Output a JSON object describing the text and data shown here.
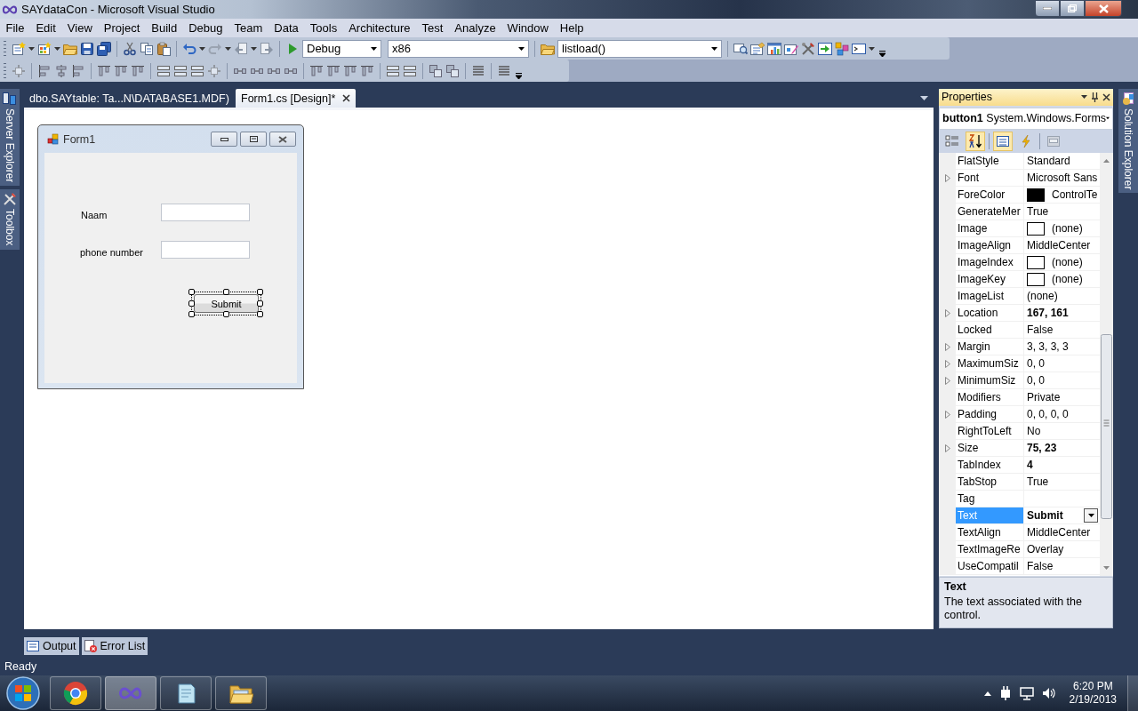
{
  "window": {
    "title": "SAYdataCon - Microsoft Visual Studio"
  },
  "menu": [
    "File",
    "Edit",
    "View",
    "Project",
    "Build",
    "Debug",
    "Team",
    "Data",
    "Tools",
    "Architecture",
    "Test",
    "Analyze",
    "Window",
    "Help"
  ],
  "toolbar": {
    "configuration": "Debug",
    "platform": "x86",
    "find": "listload()"
  },
  "left_side_tabs": [
    {
      "label": "Server Explorer",
      "kind": "server"
    },
    {
      "label": "Toolbox",
      "kind": "toolbox"
    }
  ],
  "document_tabs": [
    {
      "label": "dbo.SAYtable: Ta...N\\DATABASE1.MDF)",
      "selected": false
    },
    {
      "label": "Form1.cs [Design]*",
      "selected": true
    }
  ],
  "form": {
    "title": "Form1",
    "fields": [
      {
        "label": "Naam"
      },
      {
        "label": "phone number"
      }
    ],
    "button": {
      "text": "Submit",
      "selected": true
    }
  },
  "properties": {
    "title": "Properties",
    "object": "**button1** System.Windows.Forms",
    "view_buttons": [
      {
        "kind": "categorized",
        "selected": false
      },
      {
        "kind": "alphabetical",
        "selected": true
      },
      {
        "kind": "properties",
        "selected": true
      },
      {
        "kind": "events",
        "selected": false
      },
      {
        "kind": "pages",
        "selected": false
      }
    ],
    "rows": [
      {
        "name": "FlatStyle",
        "value": "Standard",
        "kind": "text",
        "expandable": false,
        "bold": false,
        "selected": false
      },
      {
        "name": "Font",
        "value": "Microsoft Sans",
        "kind": "text",
        "expandable": true,
        "bold": false,
        "selected": false
      },
      {
        "name": "ForeColor",
        "value": "ControlTe",
        "kind": "swatch",
        "color": "#000000",
        "expandable": false,
        "bold": false,
        "selected": false
      },
      {
        "name": "GenerateMer",
        "value": "True",
        "kind": "text",
        "expandable": false,
        "bold": false,
        "selected": false
      },
      {
        "name": "Image",
        "value": "(none)",
        "kind": "swatch",
        "color": "#ffffff",
        "expandable": false,
        "bold": false,
        "selected": false
      },
      {
        "name": "ImageAlign",
        "value": "MiddleCenter",
        "kind": "text",
        "expandable": false,
        "bold": false,
        "selected": false
      },
      {
        "name": "ImageIndex",
        "value": "(none)",
        "kind": "swatch",
        "color": "#ffffff",
        "expandable": false,
        "bold": false,
        "selected": false
      },
      {
        "name": "ImageKey",
        "value": "(none)",
        "kind": "swatch",
        "color": "#ffffff",
        "expandable": false,
        "bold": false,
        "selected": false
      },
      {
        "name": "ImageList",
        "value": "(none)",
        "kind": "text",
        "expandable": false,
        "bold": false,
        "selected": false
      },
      {
        "name": "Location",
        "value": "167, 161",
        "kind": "text",
        "expandable": true,
        "bold": true,
        "selected": false
      },
      {
        "name": "Locked",
        "value": "False",
        "kind": "text",
        "expandable": false,
        "bold": false,
        "selected": false
      },
      {
        "name": "Margin",
        "value": "3, 3, 3, 3",
        "kind": "text",
        "expandable": true,
        "bold": false,
        "selected": false
      },
      {
        "name": "MaximumSiz",
        "value": "0, 0",
        "kind": "text",
        "expandable": true,
        "bold": false,
        "selected": false
      },
      {
        "name": "MinimumSiz",
        "value": "0, 0",
        "kind": "text",
        "expandable": true,
        "bold": false,
        "selected": false
      },
      {
        "name": "Modifiers",
        "value": "Private",
        "kind": "text",
        "expandable": false,
        "bold": false,
        "selected": false
      },
      {
        "name": "Padding",
        "value": "0, 0, 0, 0",
        "kind": "text",
        "expandable": true,
        "bold": false,
        "selected": false
      },
      {
        "name": "RightToLeft",
        "value": "No",
        "kind": "text",
        "expandable": false,
        "bold": false,
        "selected": false
      },
      {
        "name": "Size",
        "value": "75, 23",
        "kind": "text",
        "expandable": true,
        "bold": true,
        "selected": false
      },
      {
        "name": "TabIndex",
        "value": "4",
        "kind": "text",
        "expandable": false,
        "bold": true,
        "selected": false
      },
      {
        "name": "TabStop",
        "value": "True",
        "kind": "text",
        "expandable": false,
        "bold": false,
        "selected": false
      },
      {
        "name": "Tag",
        "kind": "text",
        "expandable": false,
        "selected": false
      },
      {
        "name": "Text",
        "value": "Submit",
        "kind": "dropdown",
        "expandable": false,
        "bold": true,
        "selected": true
      },
      {
        "name": "TextAlign",
        "value": "MiddleCenter",
        "kind": "text",
        "expandable": false,
        "bold": false,
        "selected": false
      },
      {
        "name": "TextImageRe",
        "value": "Overlay",
        "kind": "text",
        "expandable": false,
        "bold": false,
        "selected": false
      },
      {
        "name": "UseCompatil",
        "value": "False",
        "kind": "text",
        "expandable": false,
        "bold": false,
        "selected": false
      }
    ],
    "description": {
      "title": "Text",
      "text": "The text associated with the control."
    }
  },
  "right_side_tabs": [
    {
      "label": "Solution Explorer",
      "kind": "solution"
    }
  ],
  "bottom_tabs": [
    {
      "label": "Output",
      "kind": "output"
    },
    {
      "label": "Error List",
      "kind": "errors"
    }
  ],
  "status_bar": {
    "text": "Ready"
  },
  "taskbar": {
    "apps": [
      {
        "kind": "browser",
        "selected": false
      },
      {
        "kind": "studio",
        "selected": true
      },
      {
        "kind": "notepad",
        "selected": false
      },
      {
        "kind": "explorer",
        "selected": false
      }
    ],
    "clock": {
      "time": "6:20 PM",
      "date": "2/19/2013"
    }
  }
}
